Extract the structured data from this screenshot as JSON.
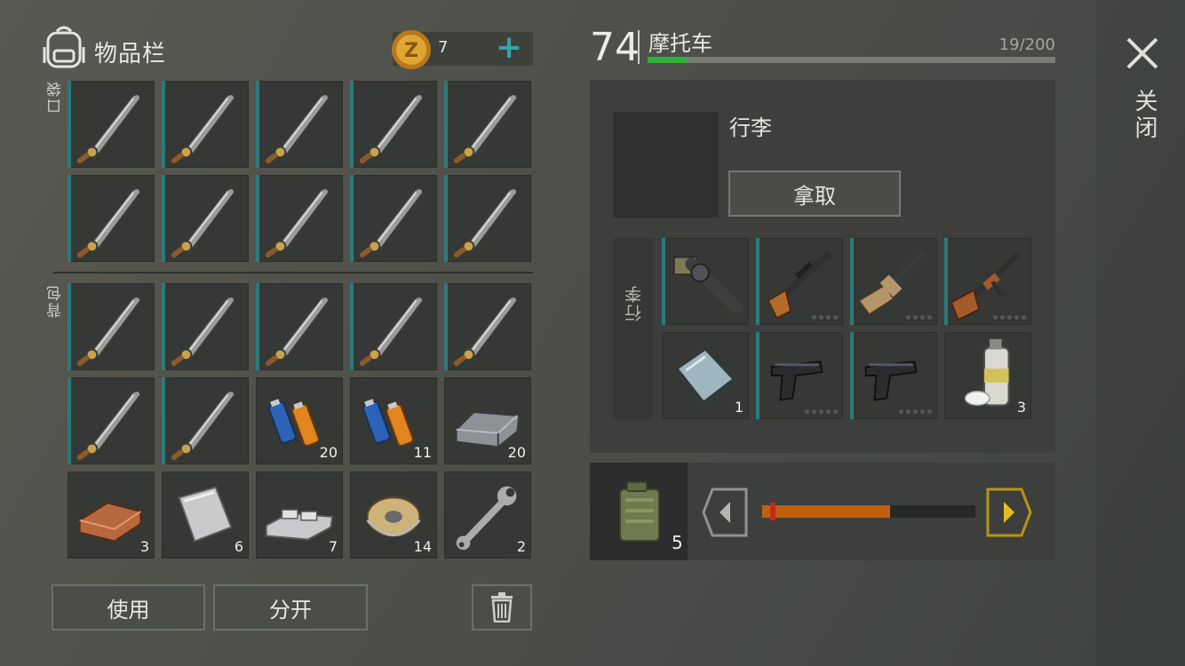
{
  "inventory": {
    "title": "物品栏",
    "coins": "7",
    "pocket_label": "口袋",
    "backpack_label": "背包",
    "pocket_slots": [
      {
        "item": "machete-icon",
        "qty": ""
      },
      {
        "item": "machete-icon",
        "qty": ""
      },
      {
        "item": "machete-icon",
        "qty": ""
      },
      {
        "item": "machete-icon",
        "qty": ""
      },
      {
        "item": "machete-icon",
        "qty": ""
      },
      {
        "item": "machete-icon",
        "qty": ""
      },
      {
        "item": "machete-icon",
        "qty": ""
      },
      {
        "item": "machete-icon",
        "qty": ""
      },
      {
        "item": "machete-icon",
        "qty": ""
      },
      {
        "item": "machete-icon",
        "qty": ""
      }
    ],
    "backpack_slots": [
      {
        "item": "machete-icon",
        "qty": ""
      },
      {
        "item": "machete-icon",
        "qty": ""
      },
      {
        "item": "machete-icon",
        "qty": ""
      },
      {
        "item": "machete-icon",
        "qty": ""
      },
      {
        "item": "machete-icon",
        "qty": ""
      },
      {
        "item": "machete-icon",
        "qty": ""
      },
      {
        "item": "machete-icon",
        "qty": ""
      },
      {
        "item": "batteries-icon",
        "qty": "20"
      },
      {
        "item": "batteries-icon",
        "qty": "11"
      },
      {
        "item": "iron-ingot-icon",
        "qty": "20"
      },
      {
        "item": "copper-ingot-icon",
        "qty": "3"
      },
      {
        "item": "metal-sheet-icon",
        "qty": "6"
      },
      {
        "item": "aluminum-bars-icon",
        "qty": "7"
      },
      {
        "item": "wire-spool-icon",
        "qty": "14"
      },
      {
        "item": "wrench-icon",
        "qty": "2"
      }
    ],
    "use_label": "使用",
    "split_label": "分开"
  },
  "vehicle": {
    "level": "74",
    "name": "摩托车",
    "capacity": "19/200",
    "capacity_fraction": 0.095,
    "panel_title": "行李",
    "take_label": "拿取",
    "cargo_label": "行李",
    "cargo_slots": [
      {
        "item": "grenade-launcher-icon",
        "qty": "",
        "dots": 0,
        "marked": true
      },
      {
        "item": "scoped-rifle-icon",
        "qty": "",
        "dots": 4,
        "marked": true
      },
      {
        "item": "assault-rifle-tan-icon",
        "qty": "",
        "dots": 4,
        "marked": true
      },
      {
        "item": "ak-rifle-icon",
        "qty": "",
        "dots": 5,
        "marked": true
      },
      {
        "item": "glass-pane-icon",
        "qty": "1",
        "dots": 0,
        "marked": false
      },
      {
        "item": "pistol-icon",
        "qty": "",
        "dots": 5,
        "marked": true
      },
      {
        "item": "pistol-icon",
        "qty": "",
        "dots": 5,
        "marked": true
      },
      {
        "item": "spray-paint-icon",
        "qty": "3",
        "dots": 0,
        "marked": false
      }
    ],
    "fuel_qty": "5",
    "fuel_fraction": 0.6
  },
  "close_label": "关闭",
  "colors": {
    "accent": "#2fa6a8",
    "slot_marker": "#2c7a7c",
    "fuel": "#c0600f",
    "progress": "#2cb234"
  }
}
